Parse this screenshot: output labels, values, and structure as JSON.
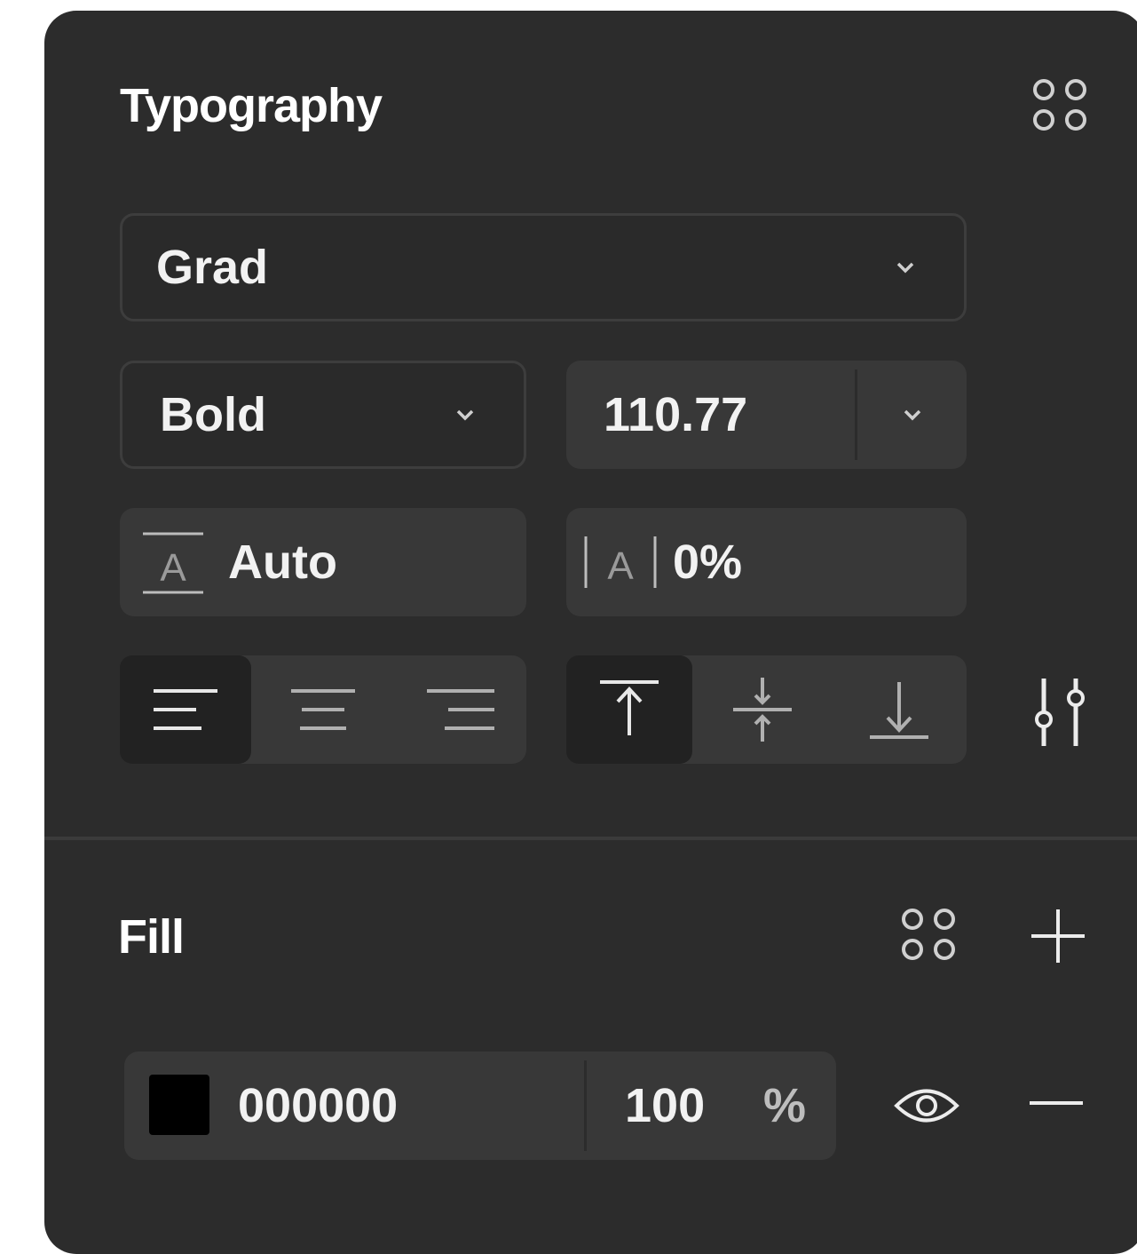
{
  "typography": {
    "title": "Typography",
    "font_family": {
      "value": "Grad"
    },
    "font_weight": {
      "value": "Bold"
    },
    "font_size": {
      "value": "110.77"
    },
    "line_height": {
      "value": "Auto"
    },
    "letter_spacing": {
      "value": "0%"
    },
    "text_align": {
      "options": [
        "left",
        "center",
        "right"
      ],
      "selected": "left"
    },
    "vertical_align": {
      "options": [
        "top",
        "middle",
        "bottom"
      ],
      "selected": "top"
    }
  },
  "fill": {
    "title": "Fill",
    "items": [
      {
        "hex": "000000",
        "opacity": "100",
        "opacity_unit": "%",
        "swatch_color": "#000000"
      }
    ]
  },
  "colors": {
    "panel_bg": "#2c2c2c",
    "field_bg": "#383838",
    "text": "#f2f2f2",
    "icon": "#bfbfbf"
  }
}
